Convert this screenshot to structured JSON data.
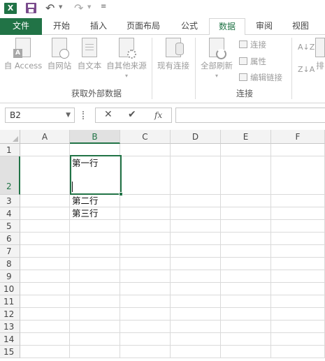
{
  "quick_access": {
    "app_icon_letter": "X",
    "undo_symbol": "↶",
    "redo_symbol": "↷",
    "dropdown_symbol": "▼",
    "customize_symbol": "≡"
  },
  "tabs": [
    {
      "label": "文件"
    },
    {
      "label": "开始"
    },
    {
      "label": "插入"
    },
    {
      "label": "页面布局"
    },
    {
      "label": "公式"
    },
    {
      "label": "数据"
    },
    {
      "label": "审阅"
    },
    {
      "label": "视图"
    }
  ],
  "active_tab": "数据",
  "ribbon": {
    "get_external": {
      "group_label": "获取外部数据",
      "from_access": "自 Access",
      "from_access_badge": "A",
      "from_web": "自网站",
      "from_text": "自文本",
      "from_other": "自其他来源",
      "from_other_dd": "▾"
    },
    "existing_connections": "现有连接",
    "connections": {
      "group_label": "连接",
      "refresh_all": "全部刷新",
      "refresh_all_dd": "▾",
      "connections_btn": "连接",
      "properties_btn": "属性",
      "edit_links_btn": "编辑链接"
    },
    "sort": {
      "sort_az": "A↓Z",
      "sort_za": "Z↓A",
      "sort_partial": "排"
    }
  },
  "formula_bar": {
    "name_box": "B2",
    "name_box_dd": "▼",
    "cancel_symbol": "✕",
    "enter_symbol": "✔",
    "fx_label": "fx",
    "formula_value": ""
  },
  "grid": {
    "columns": [
      "A",
      "B",
      "C",
      "D",
      "E",
      "F"
    ],
    "selected_column": "B",
    "rows": [
      "1",
      "2",
      "3",
      "4",
      "5",
      "6",
      "7",
      "8",
      "9",
      "10",
      "11",
      "12",
      "13",
      "14",
      "15"
    ],
    "selected_row": "2",
    "cells": {
      "B2_line1": "第一行",
      "B3": "第二行",
      "B4": "第三行"
    }
  },
  "colors": {
    "accent": "#217346",
    "file_tab_bg": "#217346",
    "header_bg": "#f3f3f3",
    "gridline": "#dadada"
  }
}
